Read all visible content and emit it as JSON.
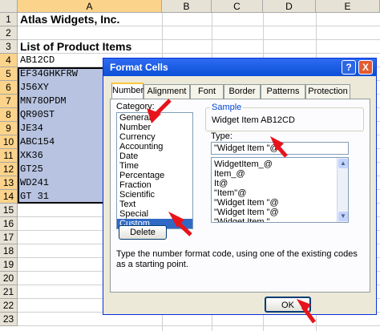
{
  "sheet": {
    "columns": [
      "A",
      "B",
      "C",
      "D",
      "E"
    ],
    "rows": [
      "1",
      "2",
      "3",
      "4",
      "5",
      "6",
      "7",
      "8",
      "9",
      "10",
      "11",
      "12",
      "13",
      "14",
      "15",
      "16",
      "17",
      "18",
      "19",
      "20",
      "21",
      "22",
      "23"
    ],
    "a1": "Atlas Widgets, Inc.",
    "a3": "List of Product Items",
    "items": [
      "AB12CD",
      "EF34GHKFRW",
      "J56XY",
      "MN78OPDM",
      "QR90ST",
      "JE34",
      "ABC154",
      "XK36",
      "GT25",
      "WD241",
      "GT 31"
    ]
  },
  "dialog": {
    "title": "Format Cells",
    "help": "?",
    "close": "X",
    "tabs": [
      "Number",
      "Alignment",
      "Font",
      "Border",
      "Patterns",
      "Protection"
    ],
    "category_label": "Category:",
    "categories": [
      "General",
      "Number",
      "Currency",
      "Accounting",
      "Date",
      "Time",
      "Percentage",
      "Fraction",
      "Scientific",
      "Text",
      "Special",
      "Custom"
    ],
    "selected_category": "Custom",
    "sample_label": "Sample",
    "sample_value": "Widget Item AB12CD",
    "type_label": "Type:",
    "type_value": "\"Widget Item \"@",
    "type_list": [
      "WidgetItem_@",
      "Item_@",
      "It@",
      "\"Item\"@",
      "\"Widget Item \"@",
      "\"Widget Item \"@",
      "\"Widget Item \""
    ],
    "delete_label": "Delete",
    "hint": "Type the number format code, using one of the existing codes as a starting point.",
    "ok_label": "OK",
    "colors": {
      "accent": "#316ac5",
      "arrow": "#e8141b",
      "title": "#0a4fd6"
    }
  }
}
